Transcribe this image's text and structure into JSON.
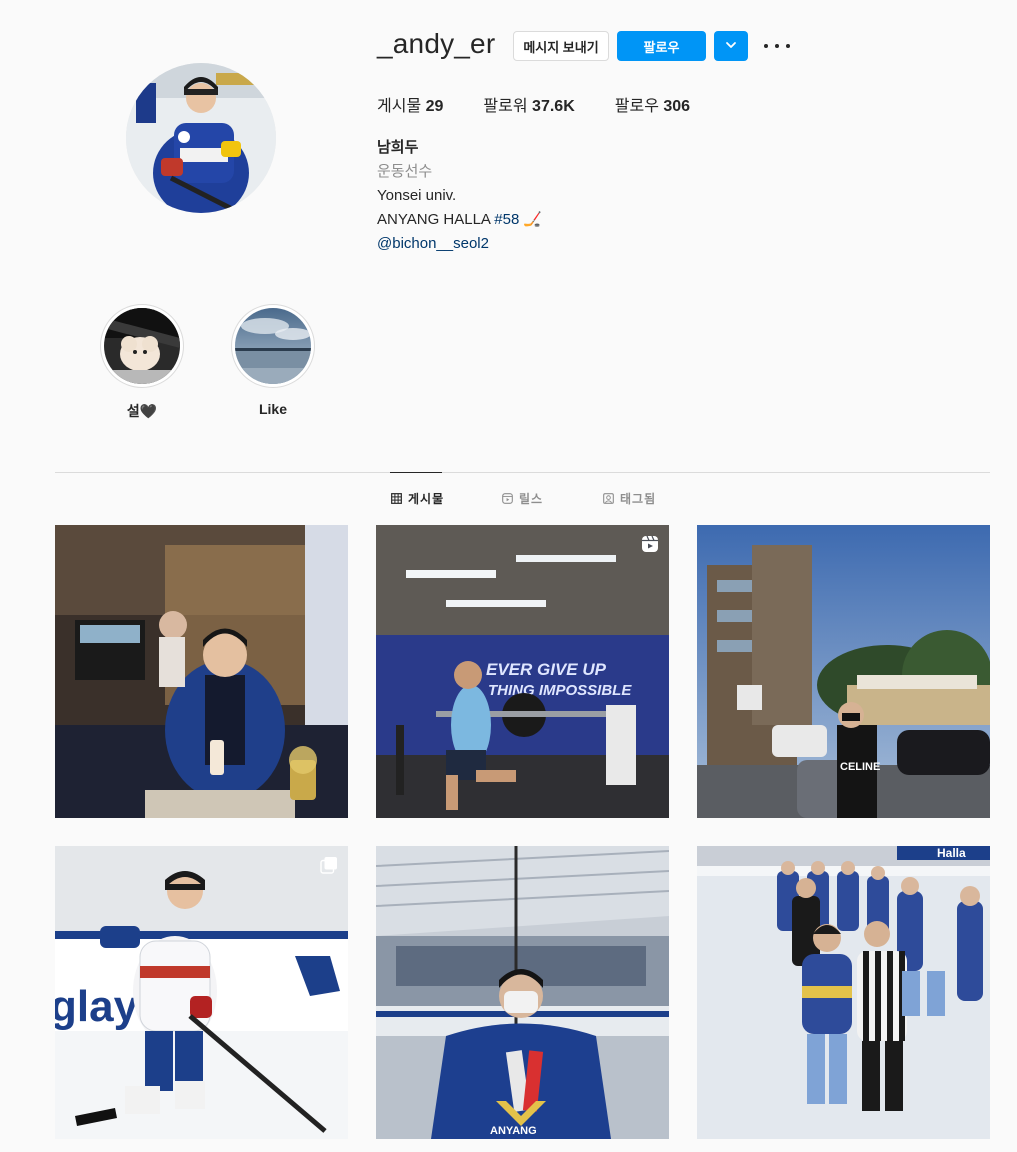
{
  "profile": {
    "username": "_andy_er",
    "message_label": "메시지 보내기",
    "follow_label": "팔로우",
    "dropdown_icon": "chevron-down-icon",
    "more_icon": "more-horizontal-icon",
    "stats": {
      "posts_label": "게시물",
      "posts_count": "29",
      "followers_label": "팔로워",
      "followers_count": "37.6K",
      "following_label": "팔로우",
      "following_count": "306"
    },
    "bio": {
      "name": "남희두",
      "category": "운동선수",
      "line1": "Yonsei univ.",
      "line2_text": "ANYANG HALLA ",
      "line2_hashtag": "#58",
      "line2_emoji": "🏒",
      "mention": "@bichon__seol2"
    }
  },
  "highlights": [
    {
      "label": "설🖤"
    },
    {
      "label": "Like"
    }
  ],
  "tabs": [
    {
      "label": "게시물",
      "icon": "grid-icon",
      "active": true
    },
    {
      "label": "릴스",
      "icon": "reels-icon",
      "active": false
    },
    {
      "label": "태그됨",
      "icon": "tagged-icon",
      "active": false
    }
  ],
  "posts": [
    {
      "badge": ""
    },
    {
      "badge": "reel-icon"
    },
    {
      "badge": ""
    },
    {
      "badge": "carousel-icon"
    },
    {
      "badge": ""
    },
    {
      "badge": ""
    }
  ],
  "colors": {
    "accent": "#0095f6",
    "link": "#00376b",
    "border": "#dbdbdb",
    "muted": "#8e8e8e"
  }
}
